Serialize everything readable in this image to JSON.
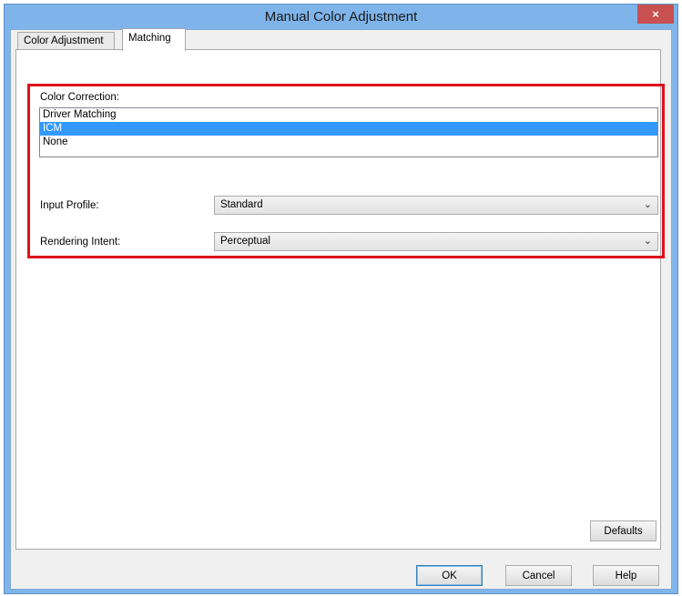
{
  "window": {
    "title": "Manual Color Adjustment",
    "close_glyph": "×"
  },
  "tabs": [
    {
      "label": "Color Adjustment",
      "active": false
    },
    {
      "label": "Matching",
      "active": true
    }
  ],
  "color_correction": {
    "label": "Color Correction:",
    "options": [
      "Driver Matching",
      "ICM",
      "None"
    ],
    "selected": "ICM"
  },
  "input_profile": {
    "label": "Input Profile:",
    "value": "Standard"
  },
  "rendering_intent": {
    "label": "Rendering Intent:",
    "value": "Perceptual"
  },
  "buttons": {
    "defaults": "Defaults",
    "ok": "OK",
    "cancel": "Cancel",
    "help": "Help"
  },
  "icons": {
    "close": "close-icon",
    "dropdown": "chevron-down-icon"
  },
  "colors": {
    "titlebar": "#7eb4ea",
    "highlight_border": "#e0101c",
    "selection": "#3399ff",
    "close_button": "#c75050"
  }
}
